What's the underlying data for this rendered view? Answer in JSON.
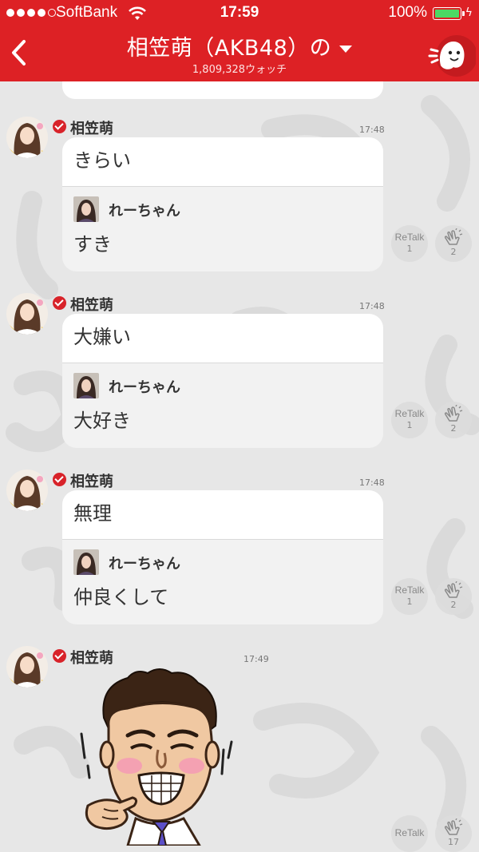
{
  "status_bar": {
    "carrier": "SoftBank",
    "time": "17:59",
    "battery_percent": "100%"
  },
  "nav": {
    "title": "相笠萌（AKB48）の",
    "watch_count": "1,809,328ウォッチ"
  },
  "posts": [
    {
      "author": "相笠萌",
      "time": "17:48",
      "message": "きらい",
      "reply_author": "れーちゃん",
      "reply_text": "すき",
      "retalk_label": "ReTalk",
      "retalk_count": "1",
      "clap_count": "2"
    },
    {
      "author": "相笠萌",
      "time": "17:48",
      "message": "大嫌い",
      "reply_author": "れーちゃん",
      "reply_text": "大好き",
      "retalk_label": "ReTalk",
      "retalk_count": "1",
      "clap_count": "2"
    },
    {
      "author": "相笠萌",
      "time": "17:48",
      "message": "無理",
      "reply_author": "れーちゃん",
      "reply_text": "仲良くして",
      "retalk_label": "ReTalk",
      "retalk_count": "1",
      "clap_count": "2"
    },
    {
      "author": "相笠萌",
      "time": "17:49",
      "sticker": "cartoon-man-pointing",
      "retalk_label": "ReTalk",
      "clap_count": "17"
    }
  ],
  "colors": {
    "header": "#dd2125",
    "background": "#e7e7e7",
    "verified": "#d8232a",
    "battery": "#4cd964"
  },
  "icons": [
    "back-chevron-icon",
    "caret-down-icon",
    "mascot-icon",
    "wifi-icon",
    "battery-icon",
    "verified-badge-icon",
    "clap-hands-icon"
  ]
}
